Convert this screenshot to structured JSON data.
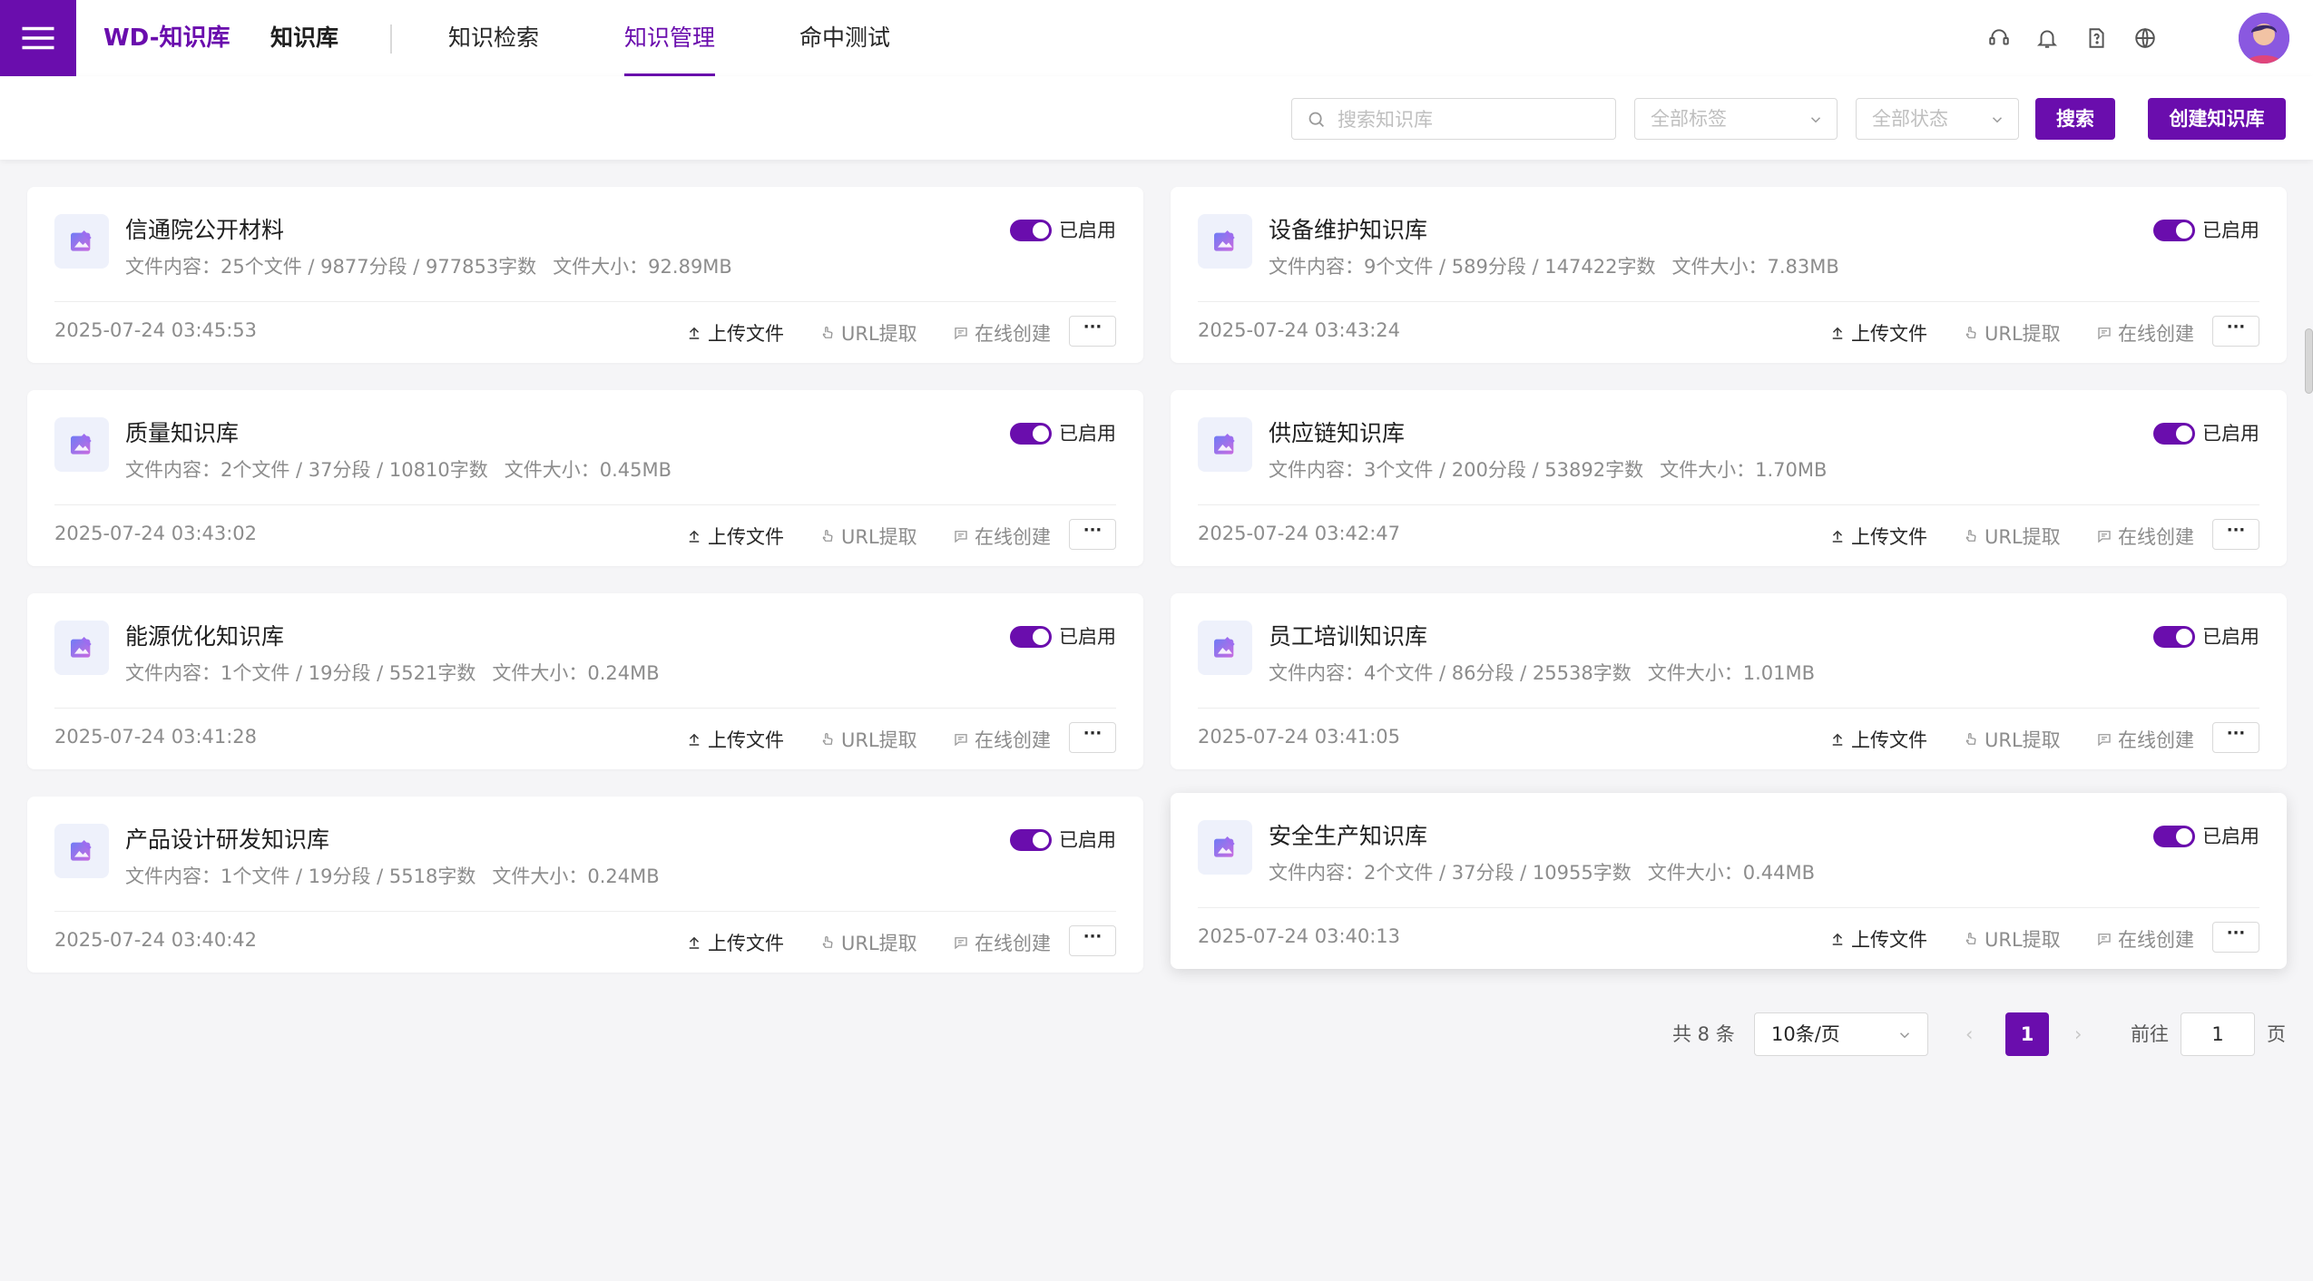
{
  "header": {
    "brand": "WD-知识库",
    "section": "知识库",
    "nav": [
      {
        "label": "知识检索",
        "active": false
      },
      {
        "label": "知识管理",
        "active": true
      },
      {
        "label": "命中测试",
        "active": false
      }
    ],
    "icons": [
      "support-icon",
      "bell-icon",
      "help-doc-icon",
      "globe-icon",
      "avatar"
    ]
  },
  "toolbar": {
    "search_placeholder": "搜索知识库",
    "tag_select": "全部标签",
    "status_select": "全部状态",
    "search_button": "搜索",
    "create_button": "创建知识库"
  },
  "card_labels": {
    "enabled": "已启用",
    "upload": "上传文件",
    "url": "URL提取",
    "online": "在线创建",
    "more": "···"
  },
  "knowledge_bases": [
    {
      "title": "信通院公开材料",
      "content": "文件内容：25个文件 / 9877分段 / 977853字数",
      "size": "文件大小：92.89MB",
      "date": "2025-07-24 03:45:53"
    },
    {
      "title": "设备维护知识库",
      "content": "文件内容：9个文件 / 589分段 / 147422字数",
      "size": "文件大小：7.83MB",
      "date": "2025-07-24 03:43:24"
    },
    {
      "title": "质量知识库",
      "content": "文件内容：2个文件 / 37分段 / 10810字数",
      "size": "文件大小：0.45MB",
      "date": "2025-07-24 03:43:02"
    },
    {
      "title": "供应链知识库",
      "content": "文件内容：3个文件 / 200分段 / 53892字数",
      "size": "文件大小：1.70MB",
      "date": "2025-07-24 03:42:47"
    },
    {
      "title": "能源优化知识库",
      "content": "文件内容：1个文件 / 19分段 / 5521字数",
      "size": "文件大小：0.24MB",
      "date": "2025-07-24 03:41:28"
    },
    {
      "title": "员工培训知识库",
      "content": "文件内容：4个文件 / 86分段 / 25538字数",
      "size": "文件大小：1.01MB",
      "date": "2025-07-24 03:41:05"
    },
    {
      "title": "产品设计研发知识库",
      "content": "文件内容：1个文件 / 19分段 / 5518字数",
      "size": "文件大小：0.24MB",
      "date": "2025-07-24 03:40:42"
    },
    {
      "title": "安全生产知识库",
      "content": "文件内容：2个文件 / 37分段 / 10955字数",
      "size": "文件大小：0.44MB",
      "date": "2025-07-24 03:40:13"
    }
  ],
  "pagination": {
    "total": "共 8 条",
    "page_size": "10条/页",
    "prev": "‹",
    "current": "1",
    "next": "›",
    "goto_label": "前往",
    "goto_value": "1",
    "page_suffix": "页"
  },
  "colors": {
    "accent": "#6a0dad",
    "background": "#f5f5f7"
  }
}
